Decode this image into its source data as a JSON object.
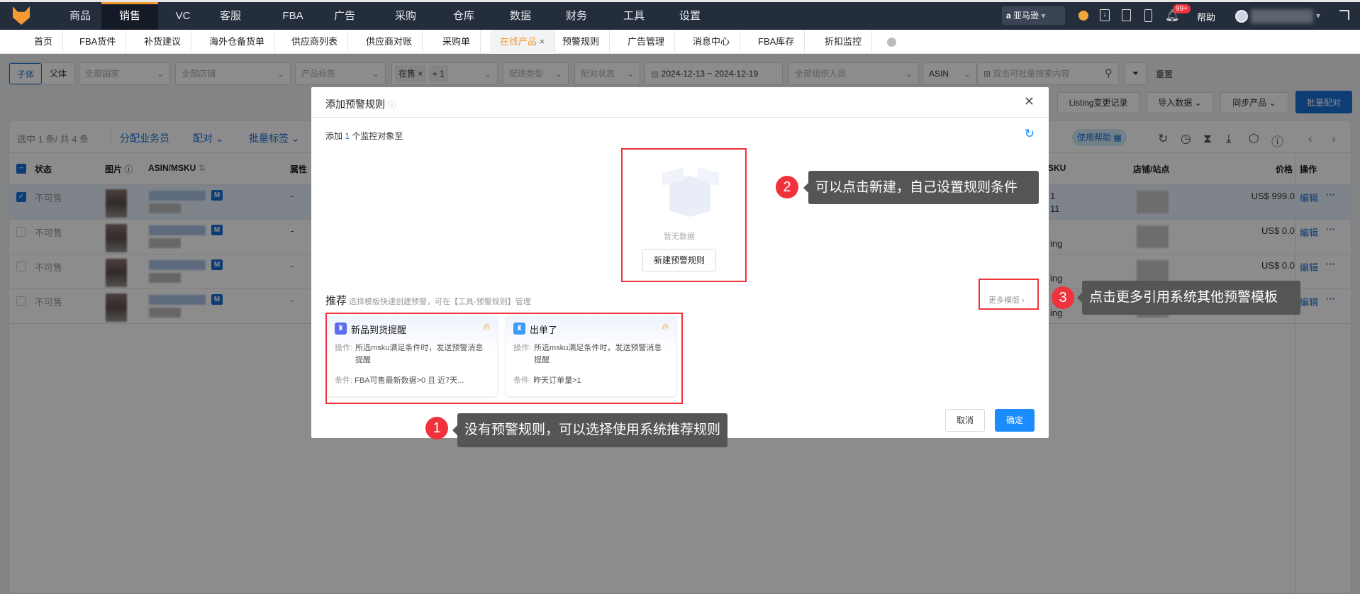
{
  "topnav": {
    "items": [
      "商品",
      "销售",
      "VC",
      "客服",
      "FBA",
      "广告",
      "采购",
      "仓库",
      "数据",
      "财务",
      "工具",
      "设置"
    ],
    "active": "销售",
    "marketplace": "亚马逊",
    "badge": "99+",
    "help": "帮助"
  },
  "tabs": {
    "items": [
      "首页",
      "FBA货件",
      "补货建议",
      "海外仓备货单",
      "供应商列表",
      "供应商对账",
      "采购单",
      "在线产品",
      "预警规则",
      "广告管理",
      "消息中心",
      "FBA库存",
      "折扣监控"
    ],
    "active": "在线产品",
    "close": "×"
  },
  "filters": {
    "child": "子体",
    "parent": "父体",
    "country": "全部国家",
    "store": "全部店铺",
    "tag": "产品标签",
    "status_tag": "在售",
    "status_more": "+ 1",
    "delivery": "配送类型",
    "pair": "配对状态",
    "date": "2024-12-13 ~ 2024-12-19",
    "staff": "全部组织人员",
    "search_type": "ASIN",
    "search_placeholder": "双击可批量搜索内容",
    "reset": "重置"
  },
  "actions": {
    "listing_log": "Listing变更记录",
    "import": "导入数据",
    "sync": "同步产品",
    "batch_pair": "批量配对"
  },
  "table": {
    "selection": "选中 1 条/ 共 4 条",
    "assign": "分配业务员",
    "pair": "配对",
    "batch_tag": "批量标签",
    "help": "使用帮助",
    "headers": {
      "status": "状态",
      "image": "图片",
      "asin": "ASIN/MSKU",
      "attr": "属性",
      "sku": "SKU",
      "store": "店铺/站点",
      "price": "价格",
      "ops": "操作"
    },
    "rows": [
      {
        "status": "不可售",
        "attr": "-",
        "sku1": "1",
        "sku2": "11",
        "price": "US$ 999.0",
        "edit": "编辑",
        "more": "···",
        "checked": true
      },
      {
        "status": "不可售",
        "attr": "-",
        "sku1": "",
        "sku2": "ing",
        "price": "US$ 0.0",
        "edit": "编辑",
        "more": "···",
        "checked": false
      },
      {
        "status": "不可售",
        "attr": "-",
        "sku1": "",
        "sku2": "ing",
        "price": "US$ 0.0",
        "edit": "编辑",
        "more": "···",
        "checked": false
      },
      {
        "status": "不可售",
        "attr": "-",
        "sku1": "",
        "sku2": "ing",
        "price": "US$ 0.0",
        "edit": "编辑",
        "more": "···",
        "checked": false
      }
    ]
  },
  "modal": {
    "title": "添加预警规则",
    "add_prefix": "添加",
    "add_count": "1",
    "add_suffix": "个监控对象至",
    "empty": "暂无数据",
    "new_rule": "新建预警规则",
    "rec_title": "推荐",
    "rec_sub": "选择模板快速创建预警，可在【工具-预警规则】管理",
    "more": "更多模版",
    "cards": [
      {
        "title": "新品到货提醒",
        "op_label": "操作:",
        "op": "所选msku满足条件时，发送预警消息提醒",
        "cond_label": "条件:",
        "cond": "FBA可售最新数据>0 且 近7天...",
        "color": "#5a6cf0"
      },
      {
        "title": "出单了",
        "op_label": "操作:",
        "op": "所选msku满足条件时，发送预警消息提醒",
        "cond_label": "条件:",
        "cond": "昨天订单量>1",
        "color": "#3d9bf5"
      }
    ],
    "cancel": "取消",
    "ok": "确定"
  },
  "callouts": [
    {
      "num": "1",
      "text": "没有预警规则，可以选择使用系统推荐规则"
    },
    {
      "num": "2",
      "text": "可以点击新建，自己设置规则条件"
    },
    {
      "num": "3",
      "text": "点击更多引用系统其他预警模板"
    }
  ]
}
